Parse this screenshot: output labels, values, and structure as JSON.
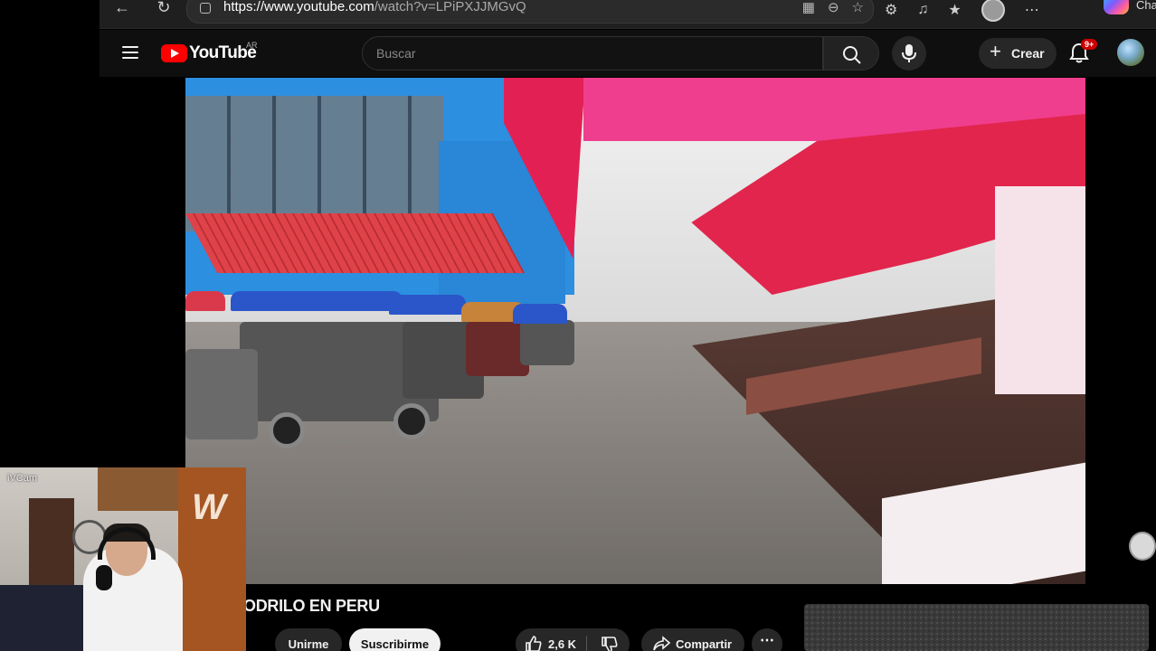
{
  "browser": {
    "url_host": "https://www.youtube.com",
    "url_path": "/watch?v=LPiPXJJMGvQ",
    "copilot_label": "Cha",
    "icons": [
      "back-icon",
      "reload-icon",
      "site-info-icon",
      "grid-icon",
      "zoom-out-icon",
      "favorite-star-icon",
      "extensions-icon",
      "media-icon",
      "collections-icon",
      "profile-icon",
      "more-icon",
      "copilot-icon"
    ]
  },
  "youtube": {
    "logo_text": "YouTube",
    "region": "AR",
    "search_placeholder": "Buscar",
    "create_label": "Crear",
    "notification_badge": "9+"
  },
  "video": {
    "title": "ODRILO EN PERU",
    "join_label": "Unirme",
    "subscribe_label": "Suscribirme",
    "like_count": "2,6 K",
    "share_label": "Compartir"
  },
  "webcam": {
    "label": "iVCam"
  },
  "colors": {
    "yt_red": "#ff0000",
    "header_bg": "#0f0f0f",
    "pill_bg": "#272727",
    "subscribe_bg": "#f1f1f1",
    "badge": "#cc0000"
  }
}
